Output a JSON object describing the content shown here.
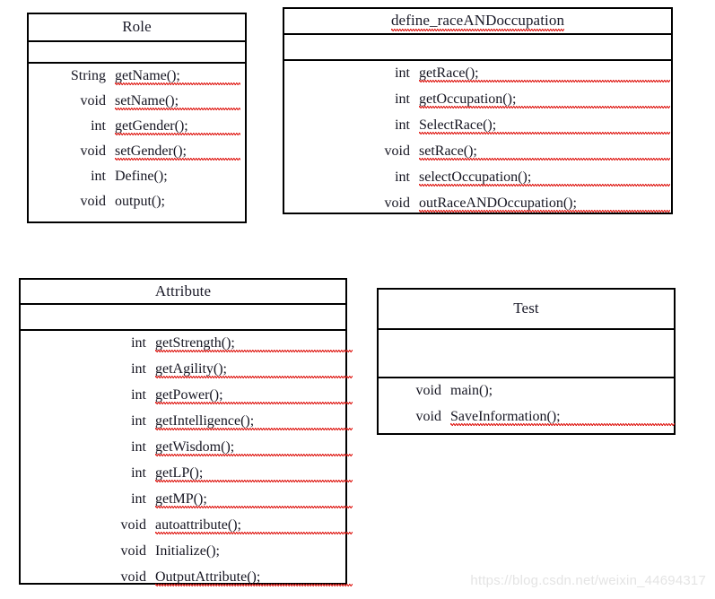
{
  "diagram": {
    "title": "UML Class Diagram",
    "background_color": "#ffffff",
    "line_color": "#000000",
    "text_color": "#161622",
    "spellcheck_underline_color": "#e0201b",
    "watermark": "https://blog.csdn.net/weixin_44694317"
  },
  "classes": [
    {
      "id": "role",
      "name": "Role",
      "misspelled_title": false,
      "attributes": [],
      "methods": [
        {
          "type": "String",
          "name": "getName();",
          "misspelled": true
        },
        {
          "type": "void",
          "name": "setName();",
          "misspelled": true
        },
        {
          "type": "int",
          "name": "getGender();",
          "misspelled": true
        },
        {
          "type": "void",
          "name": "setGender();",
          "misspelled": true
        },
        {
          "type": "int",
          "name": "Define();",
          "misspelled": false
        },
        {
          "type": "void",
          "name": "output();",
          "misspelled": false
        }
      ]
    },
    {
      "id": "define",
      "name": "define_raceANDoccupation",
      "misspelled_title": true,
      "attributes": [],
      "methods": [
        {
          "type": "int",
          "name": "getRace();",
          "misspelled": true
        },
        {
          "type": "int",
          "name": "getOccupation();",
          "misspelled": true
        },
        {
          "type": "int",
          "name": "SelectRace();",
          "misspelled": true
        },
        {
          "type": "void",
          "name": "setRace();",
          "misspelled": true
        },
        {
          "type": "int",
          "name": "selectOccupation();",
          "misspelled": true
        },
        {
          "type": "void",
          "name": "outRaceANDOccupation();",
          "misspelled": true
        }
      ]
    },
    {
      "id": "attribute",
      "name": "Attribute",
      "misspelled_title": false,
      "attributes": [],
      "methods": [
        {
          "type": "int",
          "name": "getStrength();",
          "misspelled": true
        },
        {
          "type": "int",
          "name": "getAgility();",
          "misspelled": true
        },
        {
          "type": "int",
          "name": "getPower();",
          "misspelled": true
        },
        {
          "type": "int",
          "name": "getIntelligence();",
          "misspelled": true
        },
        {
          "type": "int",
          "name": "getWisdom();",
          "misspelled": true
        },
        {
          "type": "int",
          "name": "getLP();",
          "misspelled": true
        },
        {
          "type": "int",
          "name": "getMP();",
          "misspelled": true
        },
        {
          "type": "void",
          "name": "autoattribute();",
          "misspelled": true
        },
        {
          "type": "void",
          "name": "Initialize();",
          "misspelled": false
        },
        {
          "type": "void",
          "name": "OutputAttribute();",
          "misspelled": true
        }
      ]
    },
    {
      "id": "test",
      "name": "Test",
      "misspelled_title": false,
      "attributes": [],
      "methods": [
        {
          "type": "void",
          "name": "main();",
          "misspelled": false
        },
        {
          "type": "void",
          "name": "SaveInformation();",
          "misspelled": true
        }
      ]
    }
  ]
}
